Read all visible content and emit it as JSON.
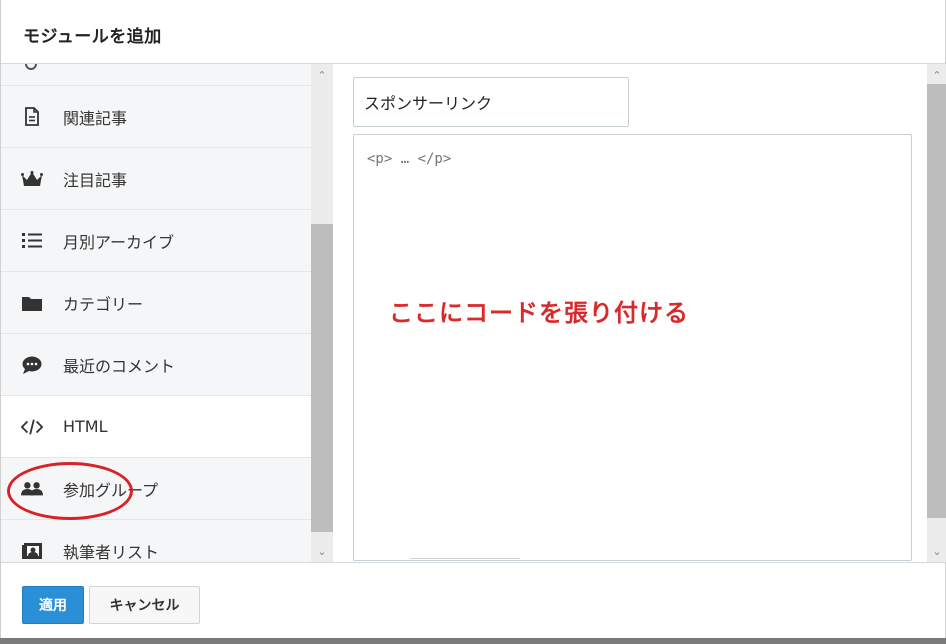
{
  "dialog": {
    "title": "モジュールを追加"
  },
  "modules": [
    {
      "label": "関連記事",
      "icon": "document-icon"
    },
    {
      "label": "注目記事",
      "icon": "crown-icon"
    },
    {
      "label": "月別アーカイブ",
      "icon": "list-icon"
    },
    {
      "label": "カテゴリー",
      "icon": "folder-icon"
    },
    {
      "label": "最近のコメント",
      "icon": "comment-icon"
    },
    {
      "label": "HTML",
      "icon": "code-icon",
      "selected": true
    },
    {
      "label": "参加グループ",
      "icon": "users-icon"
    },
    {
      "label": "執筆者リスト",
      "icon": "contact-card-icon"
    }
  ],
  "editor": {
    "title_value": "スポンサーリンク",
    "code_placeholder": "<p> … </p>",
    "annotation": "ここにコードを張り付ける"
  },
  "footer": {
    "apply_label": "適用",
    "cancel_label": "キャンセル"
  },
  "colors": {
    "accent": "#2a8fd7",
    "annotation": "#d9292b"
  }
}
